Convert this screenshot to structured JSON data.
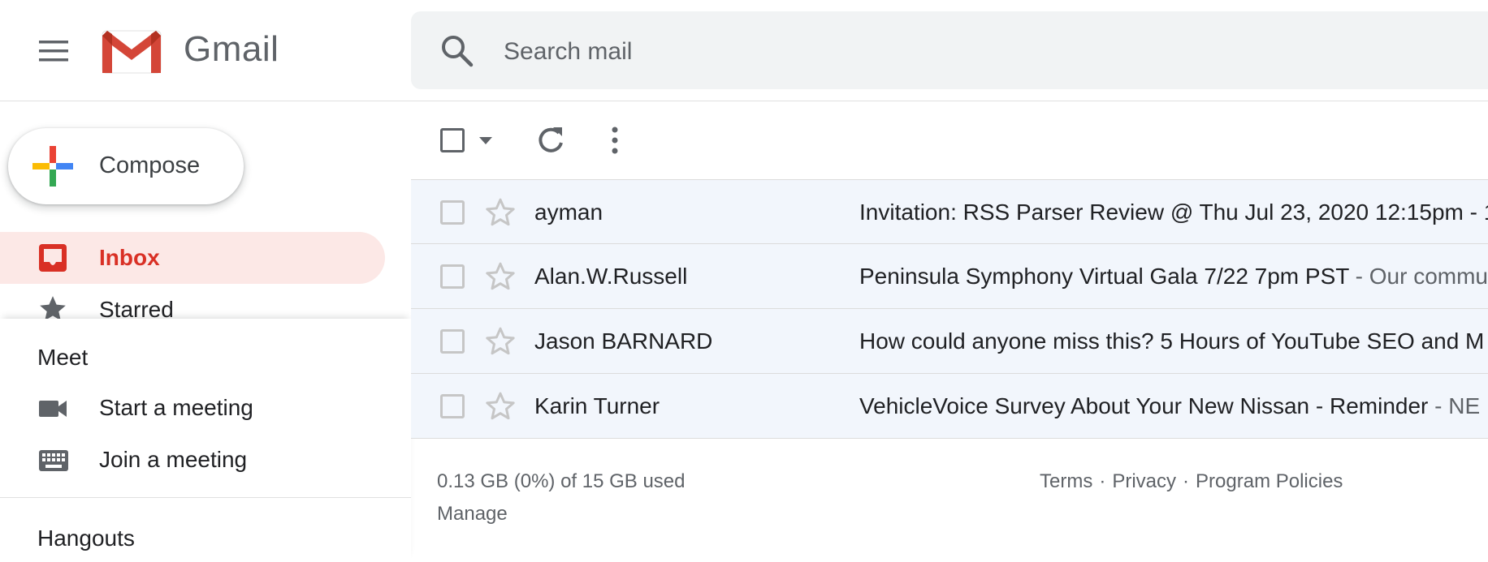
{
  "header": {
    "menu_icon": "hamburger-menu-icon",
    "brand": "Gmail",
    "search_placeholder": "Search mail"
  },
  "sidebar": {
    "compose_label": "Compose",
    "items": [
      {
        "label": "Inbox",
        "icon": "inbox-icon",
        "active": true
      },
      {
        "label": "Starred",
        "icon": "star-icon"
      }
    ]
  },
  "meet": {
    "title": "Meet",
    "items": [
      {
        "label": "Start a meeting",
        "icon": "video-camera-icon"
      },
      {
        "label": "Join a meeting",
        "icon": "keyboard-icon"
      }
    ]
  },
  "hangouts": {
    "title": "Hangouts"
  },
  "emails": [
    {
      "sender": "ayman",
      "subject": "Invitation: RSS Parser Review @ Thu Jul 23, 2020 12:15pm - 1",
      "snippet": ""
    },
    {
      "sender": "Alan.W.Russell",
      "subject": "Peninsula Symphony Virtual Gala 7/22 7pm PST",
      "snippet": " - Our commu"
    },
    {
      "sender": "Jason BARNARD",
      "subject": "How could anyone miss this? 5 Hours of YouTube SEO and M",
      "snippet": ""
    },
    {
      "sender": "Karin Turner",
      "subject": "VehicleVoice Survey About Your New Nissan - Reminder",
      "snippet": " - NE"
    }
  ],
  "footer": {
    "storage": "0.13 GB (0%) of 15 GB used",
    "manage": "Manage",
    "links": [
      "Terms",
      "Privacy",
      "Program Policies"
    ],
    "separator": "·"
  },
  "colors": {
    "accent_red": "#d93025",
    "inbox_highlight": "#fce8e6",
    "row_background": "#f2f6fc"
  }
}
